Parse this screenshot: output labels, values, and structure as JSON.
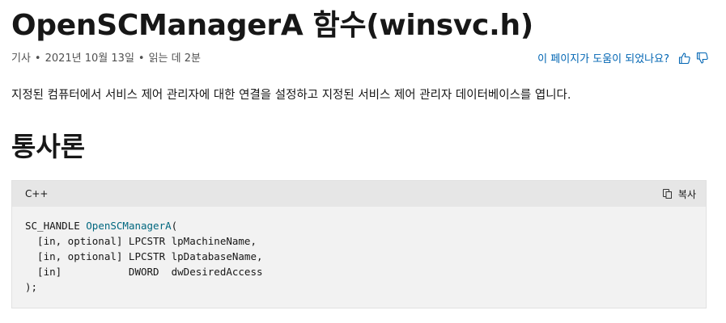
{
  "article": {
    "title": "OpenSCManagerA 함수(winsvc.h)",
    "meta": {
      "type": "기사",
      "date": "2021년 10월 13일",
      "read_time": "읽는 데 2분"
    },
    "feedback": {
      "question": "이 페이지가 도움이 되었나요?",
      "like_icon": "thumbs-up-icon",
      "dislike_icon": "thumbs-down-icon"
    },
    "description": "지정된 컴퓨터에서 서비스 제어 관리자에 대한 연결을 설정하고 지정된 서비스 제어 관리자 데이터베이스를 엽니다.",
    "section_heading": "통사론"
  },
  "code_block": {
    "language": "C++",
    "copy_label": "복사",
    "copy_icon": "copy-icon",
    "lines": {
      "l1_type": "SC_HANDLE ",
      "l1_fn": "OpenSCManagerA",
      "l1_paren": "(",
      "l2": "  [in, optional] LPCSTR lpMachineName,",
      "l3": "  [in, optional] LPCSTR lpDatabaseName,",
      "l4": "  [in]           DWORD  dwDesiredAccess",
      "l5": ");"
    }
  },
  "colors": {
    "link": "#0065b3",
    "function_name": "#00677f",
    "code_background": "#f2f2f2",
    "code_header": "#e6e6e6"
  }
}
